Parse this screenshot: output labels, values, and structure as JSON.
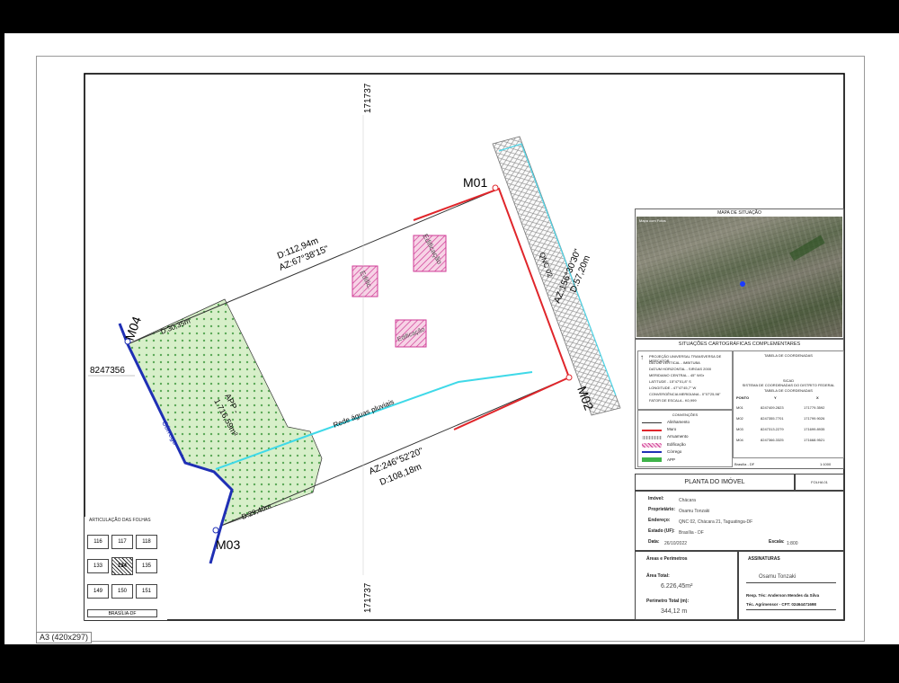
{
  "sheet": {
    "size_label": "A3  (420x297)"
  },
  "grid": {
    "top_coord": "171737",
    "bottom_coord": "171737",
    "left_coord": "8247356"
  },
  "plan": {
    "markers": [
      "M01",
      "M02",
      "M03",
      "M04"
    ],
    "segments": [
      {
        "d": "D:112,94m",
        "az": "AZ:67°38'15\""
      },
      {
        "d": "D:57,20m",
        "az": "AZ:156°30'30\""
      },
      {
        "d": "D:108,18m",
        "az": "AZ:246°52'20\""
      },
      {
        "d": "D:30,35m"
      },
      {
        "d": "D:29,40m"
      }
    ],
    "street": "QNC 02",
    "app_label": "APP -",
    "app_area": "1.716,59m²",
    "buildings": [
      "Edificação",
      "Edific.",
      "Edificação"
    ],
    "stream": "Córrego",
    "drain": "Rede águas pluviais"
  },
  "articulation": {
    "title": "ARTICULAÇÃO DAS FOLHAS",
    "cells": [
      "116",
      "117",
      "118",
      "133",
      "134",
      "135",
      "149",
      "150",
      "151"
    ],
    "footer": "BRASÍLIA-DF"
  },
  "situation": {
    "title": "MAPA DE SITUAÇÃO",
    "map_label": "Mapa com Fotos",
    "notes_title": "SITUAÇÕES CARTOGRÁFICAS COMPLEMENTARES",
    "notes": [
      "PROJEÇÃO UNIVERSAL TRANSVERSA DE MERCATOR",
      "DATUM VERTICAL - IMBITUBA",
      "DATUM HORIZONTAL - SIRGAS 2000",
      "MERIDIANO CENTRAL - 45° WGr",
      "LATITUDE - 15°47'01,8\" S",
      "LONGITUDE - 47°47'45,7\" W",
      "CONVERGÊNCIA MERIDIANA - 0°07'25,98\"",
      "FATOR DE ESCALA - K0,999"
    ],
    "coord_title": "TABELA DE COORDENADAS",
    "coord_sub": "SICAD",
    "coord_sub2": "SISTEMA DE COORDENADAS DO DISTRITO FEDERAL",
    "coord_sub3": "TABELA DE COORDENADAS",
    "coord_headers": [
      "PONTO",
      "Y",
      "X"
    ],
    "coord_rows": [
      [
        "M01",
        "8247409.2823",
        "171779.3592"
      ],
      [
        "M02",
        "8247355.7701",
        "171799.9026"
      ],
      [
        "M03",
        "8247313.2279",
        "171699.8935"
      ],
      [
        "M04",
        "8247366.3325",
        "171668.9521"
      ]
    ],
    "conventions_title": "CONVENÇÕES",
    "conventions": [
      "Alinhamento",
      "Muro",
      "Arruamento",
      "Edificação",
      "Córrego",
      "APP"
    ],
    "bottom_left": "Brasília - DF",
    "bottom_right": "1:1000"
  },
  "title_block": {
    "heading": "PLANTA DO IMÓVEL",
    "sheet_no": "FOLHA 01",
    "rows": [
      {
        "label": "Imóvel:",
        "value": "Chácara"
      },
      {
        "label": "Proprietário:",
        "value": "Osamu Tonzaki"
      },
      {
        "label": "Endereço:",
        "value": "QNC 02, Chácara 21, Taguatinga-DF"
      },
      {
        "label": "Estado (UF):",
        "value": "Brasília - DF"
      },
      {
        "label": "Data:",
        "value": "26/10/2022"
      }
    ],
    "scale_label": "Escala:",
    "scale_value": "1:800",
    "areas_title": "Áreas e Perímetros",
    "area_label": "Área Total:",
    "area_value": "6.226,45m²",
    "perimeter_label": "Perímetro Total (m):",
    "perimeter_value": "344,12 m",
    "signatures_title": "ASSINATURAS",
    "owner_sig": "Osamu Tonzaki",
    "tech_label": "Resp. Téc: Anderson Mendes da Silva",
    "tech_reg": "Téc. Agrimensor - CFT: 02464471698"
  },
  "colors": {
    "wall": "#e0262b",
    "stream": "#1f2fb5",
    "drain": "#3fd9e8",
    "app": "#3fb34a",
    "building": "#d23a9a"
  }
}
